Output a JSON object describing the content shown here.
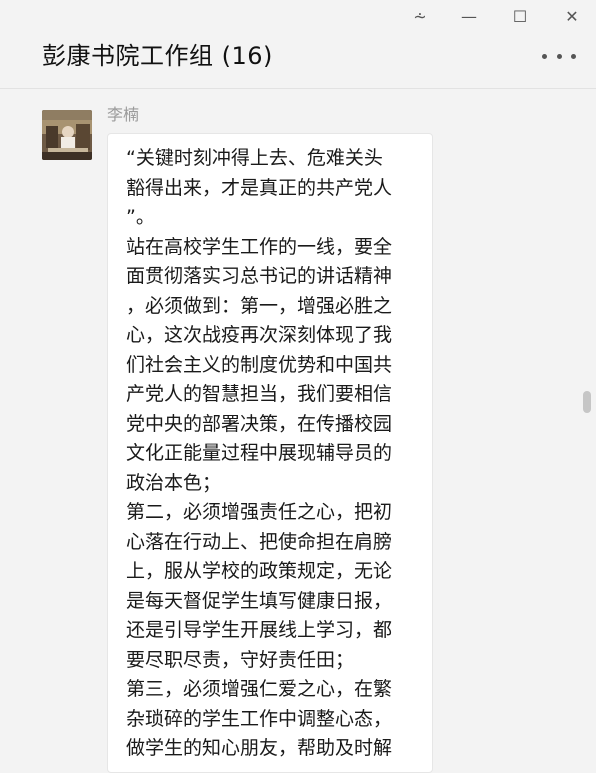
{
  "window": {
    "pin_glyph": "⩪",
    "minimize_glyph": "—",
    "maximize_glyph": "☐",
    "close_glyph": "✕"
  },
  "chat": {
    "title": "彭康书院工作组 (16)"
  },
  "message": {
    "sender": "李楠",
    "text": "“关键时刻冲得上去、危难关头\n豁得出来，才是真正的共产党人\n”。\n站在高校学生工作的一线，要全\n面贯彻落实习总书记的讲话精神\n，必须做到：第一，增强必胜之\n心，这次战疫再次深刻体现了我\n们社会主义的制度优势和中国共\n产党人的智慧担当，我们要相信\n党中央的部署决策，在传播校园\n文化正能量过程中展现辅导员的\n政治本色；\n第二，必须增强责任之心，把初\n心落在行动上、把使命担在肩膀\n上，服从学校的政策规定，无论\n是每天督促学生填写健康日报，\n还是引导学生开展线上学习，都\n要尽职尽责，守好责任田；\n第三，必须增强仁爱之心，在繁\n杂琐碎的学生工作中调整心态，\n做学生的知心朋友，帮助及时解"
  },
  "icons": {
    "avatar": "user-avatar-photo",
    "more": "more-options-icon"
  }
}
